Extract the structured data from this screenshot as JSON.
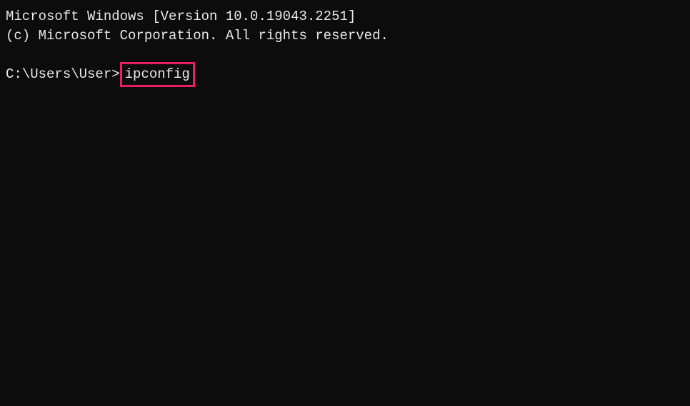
{
  "terminal": {
    "header_line1": "Microsoft Windows [Version 10.0.19043.2251]",
    "header_line2": "(c) Microsoft Corporation. All rights reserved.",
    "prompt": "C:\\Users\\User>",
    "command": "ipconfig"
  }
}
